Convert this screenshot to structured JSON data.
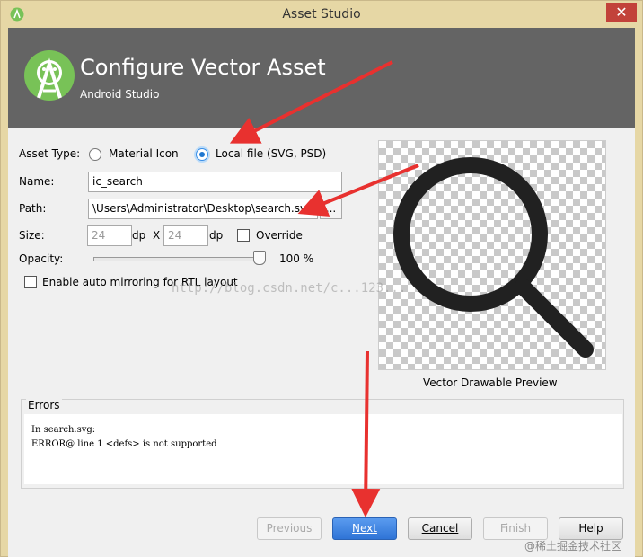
{
  "window": {
    "title": "Asset Studio",
    "close_glyph": "✕"
  },
  "header": {
    "title": "Configure Vector Asset",
    "subtitle": "Android Studio"
  },
  "form": {
    "asset_type_label": "Asset Type:",
    "asset_type_options": [
      {
        "label": "Material Icon",
        "selected": false
      },
      {
        "label": "Local file (SVG, PSD)",
        "selected": true
      }
    ],
    "name_label": "Name:",
    "name_value": "ic_search",
    "path_label": "Path:",
    "path_value": "\\Users\\Administrator\\Desktop\\search.svg",
    "browse_label": "...",
    "size_label": "Size:",
    "size_width": "24",
    "size_height": "24",
    "unit_dp": "dp",
    "size_x": "X",
    "override_label": "Override",
    "opacity_label": "Opacity:",
    "opacity_percent": "100 %",
    "opacity_value": 100,
    "mirroring_label": "Enable auto mirroring for RTL layout"
  },
  "preview": {
    "caption": "Vector Drawable Preview",
    "icon": "search-icon",
    "icon_color": "#212121"
  },
  "errors": {
    "legend": "Errors",
    "lines": [
      "In search.svg:",
      "ERROR@ line 1 <defs> is not supported"
    ]
  },
  "buttons": {
    "previous": "Previous",
    "next": "Next",
    "cancel": "Cancel",
    "finish": "Finish",
    "help": "Help"
  },
  "watermarks": {
    "overlay": "http://blog.csdn.net/c...123...",
    "corner": "@稀土掘金技术社区"
  },
  "colors": {
    "header_bg": "#646464",
    "accent": "#2f74d6",
    "android_green": "#78c257",
    "annotation_arrow": "#e8312f"
  }
}
